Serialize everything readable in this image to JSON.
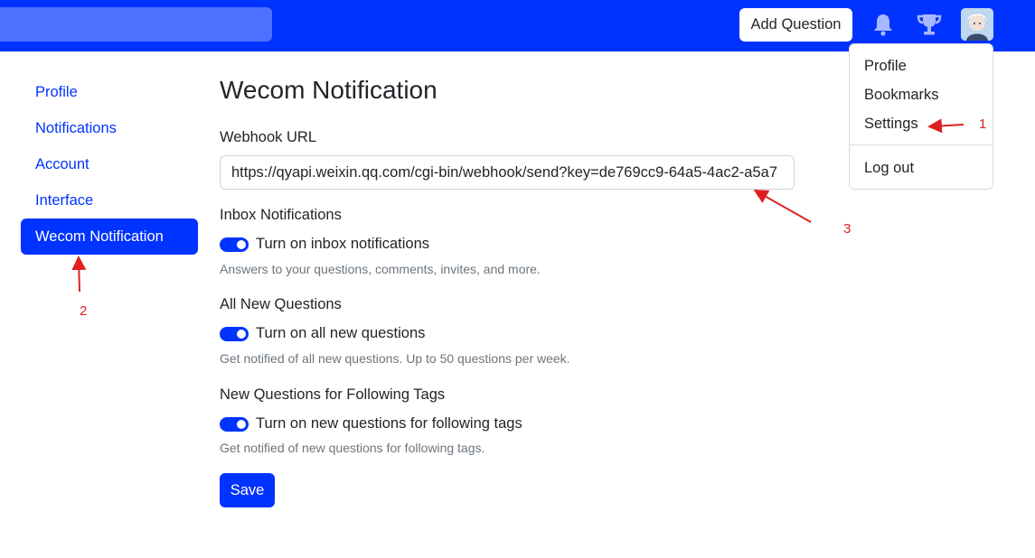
{
  "navbar": {
    "search_placeholder": "",
    "add_question_label": "Add Question",
    "color": "#0033ff"
  },
  "sidebar": {
    "items": [
      {
        "label": "Profile"
      },
      {
        "label": "Notifications"
      },
      {
        "label": "Account"
      },
      {
        "label": "Interface"
      },
      {
        "label": "Wecom Notification",
        "active": true
      }
    ]
  },
  "main": {
    "title": "Wecom Notification",
    "webhook": {
      "label": "Webhook URL",
      "value": "https://qyapi.weixin.qq.com/cgi-bin/webhook/send?key=de769cc9-64a5-4ac2-a5a7"
    },
    "sections": [
      {
        "heading": "Inbox Notifications",
        "toggle_label": "Turn on inbox notifications",
        "enabled": true,
        "help": "Answers to your questions, comments, invites, and more."
      },
      {
        "heading": "All New Questions",
        "toggle_label": "Turn on all new questions",
        "enabled": true,
        "help": "Get notified of all new questions. Up to 50 questions per week."
      },
      {
        "heading": "New Questions for Following Tags",
        "toggle_label": "Turn on new questions for following tags",
        "enabled": true,
        "help": "Get notified of new questions for following tags."
      }
    ],
    "save_label": "Save"
  },
  "user_menu": {
    "items": [
      "Profile",
      "Bookmarks",
      "Settings"
    ],
    "logout_label": "Log out"
  },
  "annotations": [
    "1",
    "2",
    "3"
  ],
  "icons": {
    "bell": "bell-icon",
    "trophy": "trophy-icon",
    "avatar": "avatar"
  }
}
